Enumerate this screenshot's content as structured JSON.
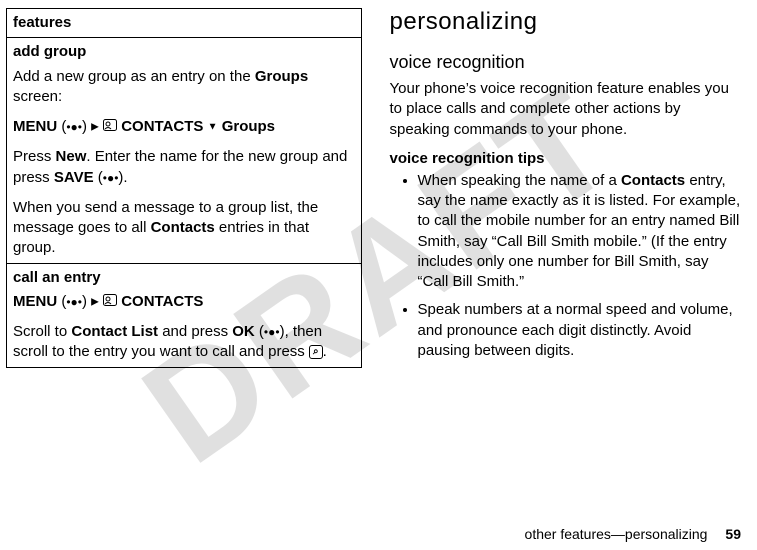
{
  "watermark": "DRAFT",
  "left": {
    "header": "features",
    "addGroup": {
      "title": "add group",
      "p1_a": "Add a new group as an entry on the ",
      "p1_b": "Groups",
      "p1_c": " screen:",
      "menu_a": "MENU",
      "menu_b": "CONTACTS",
      "menu_c": "Groups",
      "p2_a": "Press ",
      "p2_b": "New",
      "p2_c": ". Enter the name for the new group and press ",
      "p2_d": "SAVE",
      "p2_e": ".",
      "p3_a": "When you send a message to a group list, the message goes to all ",
      "p3_b": "Contacts",
      "p3_c": " entries in that group."
    },
    "callEntry": {
      "title": "call an entry",
      "menu_a": "MENU",
      "menu_b": "CONTACTS",
      "p1_a": "Scroll to ",
      "p1_b": "Contact List",
      "p1_c": " and press ",
      "p1_d": "OK",
      "p1_e": ", then scroll to the entry you want to call and press ",
      "p1_f": "."
    }
  },
  "right": {
    "h1": "personalizing",
    "h2": "voice recognition",
    "intro": "Your phone’s voice recognition feature enables you to place calls and complete other actions by speaking commands to your phone.",
    "tipsTitle": "voice recognition tips",
    "tip1_a": "When speaking the name of a ",
    "tip1_b": "Contacts",
    "tip1_c": " entry, say the name exactly as it is listed. For example, to call the mobile number for an entry named Bill Smith, say “Call Bill Smith mobile.” (If the entry includes only one number for Bill Smith, say “Call Bill Smith.”",
    "tip2": "Speak numbers at a normal speed and volume, and pronounce each digit distinctly. Avoid pausing between digits."
  },
  "footer": {
    "text": "other features—personalizing",
    "page": "59"
  }
}
